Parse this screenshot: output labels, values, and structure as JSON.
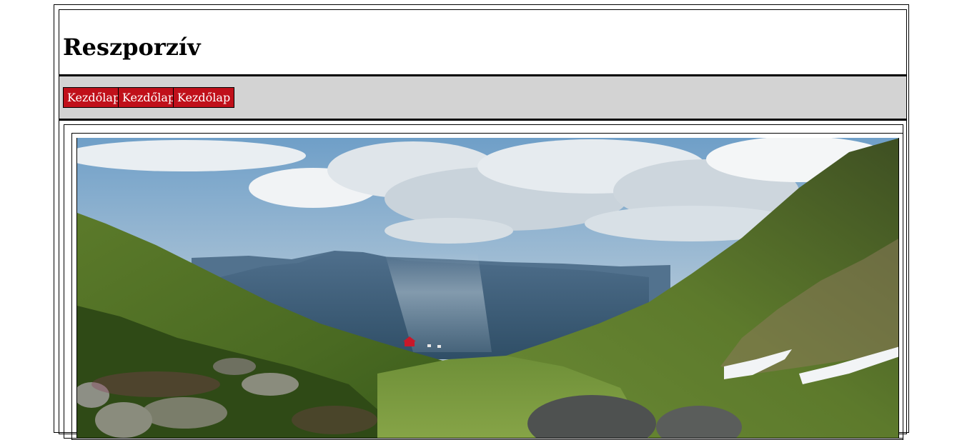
{
  "header": {
    "title": "Reszporzív"
  },
  "nav": {
    "items": [
      {
        "label": "Kezdőlap"
      },
      {
        "label": "Kezdőlap"
      },
      {
        "label": "Kezdőlap"
      }
    ]
  },
  "colors": {
    "nav_background": "#d3d3d3",
    "button_background": "#c0101a",
    "button_text": "#ffffff"
  },
  "main": {
    "image": {
      "subject": "mountain-valley-photo"
    }
  }
}
